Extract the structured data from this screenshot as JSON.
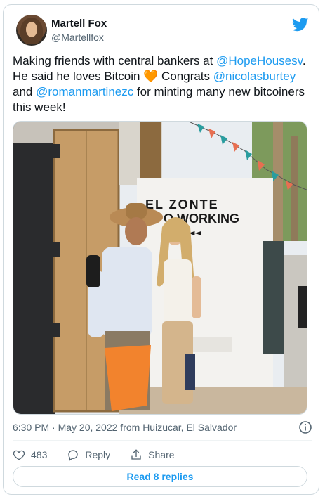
{
  "user": {
    "name": "Martell Fox",
    "handle": "@Martellfox"
  },
  "tweet": {
    "text_1": "Making friends with central bankers at ",
    "mention_1": "@HopeHousesv",
    "text_2": ". He said he loves Bitcoin ",
    "emoji": "🧡",
    "text_3": " Congrats ",
    "mention_2": "@nicolasburtey",
    "text_4": " and ",
    "mention_3": "@romanmartinezc",
    "text_5": " for minting many new bitcoiners this week!"
  },
  "photo": {
    "sign_line_1": "EL ZONTE",
    "sign_line_2": "O WORKING",
    "sign_arrows": "◄◄◄"
  },
  "meta": {
    "timestamp": "6:30 PM · May 20, 2022 from Huizucar, El Salvador"
  },
  "actions": {
    "likes": "483",
    "reply_label": "Reply",
    "share_label": "Share"
  },
  "read_replies_label": "Read 8 replies",
  "colors": {
    "accent": "#1d9bf0",
    "text": "#0f1419",
    "secondary": "#536471",
    "border": "#cfd9de"
  },
  "icons": [
    "twitter-bird-icon",
    "info-icon",
    "heart-icon",
    "reply-icon",
    "share-icon"
  ]
}
